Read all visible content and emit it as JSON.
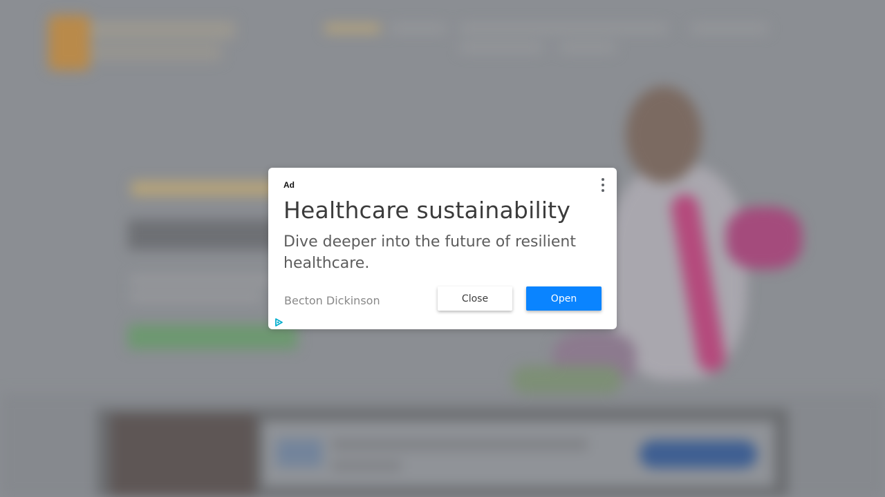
{
  "ad": {
    "label": "Ad",
    "headline": "Healthcare sustainability",
    "description": "Dive deeper into the future of resilient healthcare.",
    "advertiser": "Becton Dickinson",
    "close_label": "Close",
    "open_label": "Open",
    "icons": {
      "menu": "more-vert-icon",
      "adchoices": "adchoices-icon"
    },
    "colors": {
      "open_button": "#0a84ff",
      "adchoices": "#00aecd"
    }
  },
  "background": {
    "overlay_color": "#8b8e93"
  }
}
